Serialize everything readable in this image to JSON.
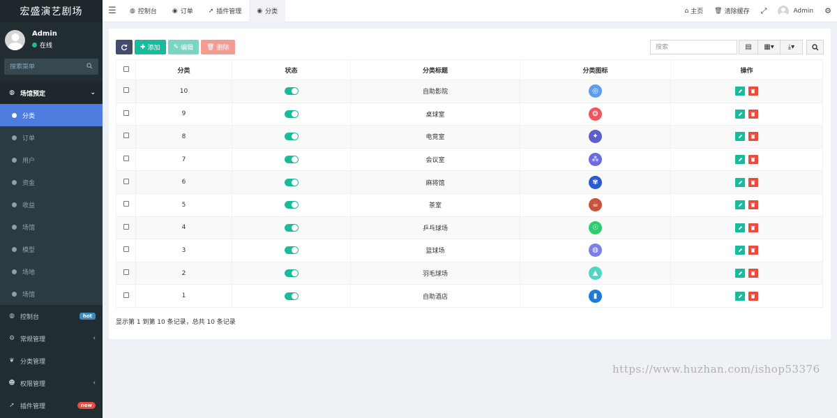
{
  "brand": "宏盛演艺剧场",
  "user": {
    "name": "Admin",
    "status": "在线"
  },
  "sidebar": {
    "search_placeholder": "搜索菜单",
    "group": {
      "label": "场馆预定"
    },
    "sub_items": [
      {
        "label": "分类",
        "active": true
      },
      {
        "label": "订单"
      },
      {
        "label": "用户"
      },
      {
        "label": "资金"
      },
      {
        "label": "收益"
      },
      {
        "label": "场馆"
      },
      {
        "label": "模型"
      },
      {
        "label": "场地"
      },
      {
        "label": "场馆"
      }
    ],
    "items": [
      {
        "label": "控制台",
        "badge": "hot"
      },
      {
        "label": "常规管理"
      },
      {
        "label": "分类管理"
      },
      {
        "label": "权限管理"
      },
      {
        "label": "插件管理",
        "badge": "new"
      }
    ]
  },
  "topbar": {
    "tabs": [
      {
        "label": "控制台"
      },
      {
        "label": "订单"
      },
      {
        "label": "插件管理"
      },
      {
        "label": "分类"
      }
    ],
    "home": "主页",
    "clear_cache": "清除缓存",
    "admin": "Admin"
  },
  "toolbar": {
    "add": "添加",
    "edit": "编辑",
    "delete": "删除",
    "search_placeholder": "搜索"
  },
  "table": {
    "headers": [
      "分类",
      "状态",
      "分类标题",
      "分类图标",
      "操作"
    ],
    "rows": [
      {
        "id": "10",
        "title": "自助影院",
        "icon_color": "#5b9ef0",
        "icon": "film-icon"
      },
      {
        "id": "9",
        "title": "桌球室",
        "icon_color": "#f0555e",
        "icon": "billiard-icon"
      },
      {
        "id": "8",
        "title": "电竞室",
        "icon_color": "#5a5fc9",
        "icon": "gamepad-icon"
      },
      {
        "id": "7",
        "title": "会议室",
        "icon_color": "#6b6ae0",
        "icon": "meeting-icon"
      },
      {
        "id": "6",
        "title": "麻将馆",
        "icon_color": "#2a5bd0",
        "icon": "mahjong-icon"
      },
      {
        "id": "5",
        "title": "茶室",
        "icon_color": "#c9533a",
        "icon": "tea-icon"
      },
      {
        "id": "4",
        "title": "乒乓球场",
        "icon_color": "#2ecc71",
        "icon": "pingpong-icon"
      },
      {
        "id": "3",
        "title": "篮球场",
        "icon_color": "#7b7ee8",
        "icon": "basketball-icon"
      },
      {
        "id": "2",
        "title": "羽毛球场",
        "icon_color": "#4fd6c4",
        "icon": "badminton-icon"
      },
      {
        "id": "1",
        "title": "自助酒店",
        "icon_color": "#1d7ad8",
        "icon": "hotel-icon"
      }
    ]
  },
  "pagination": {
    "info": "显示第 1 到第 10 条记录，总共 10 条记录"
  },
  "watermark": "https://www.huzhan.com/ishop53376"
}
